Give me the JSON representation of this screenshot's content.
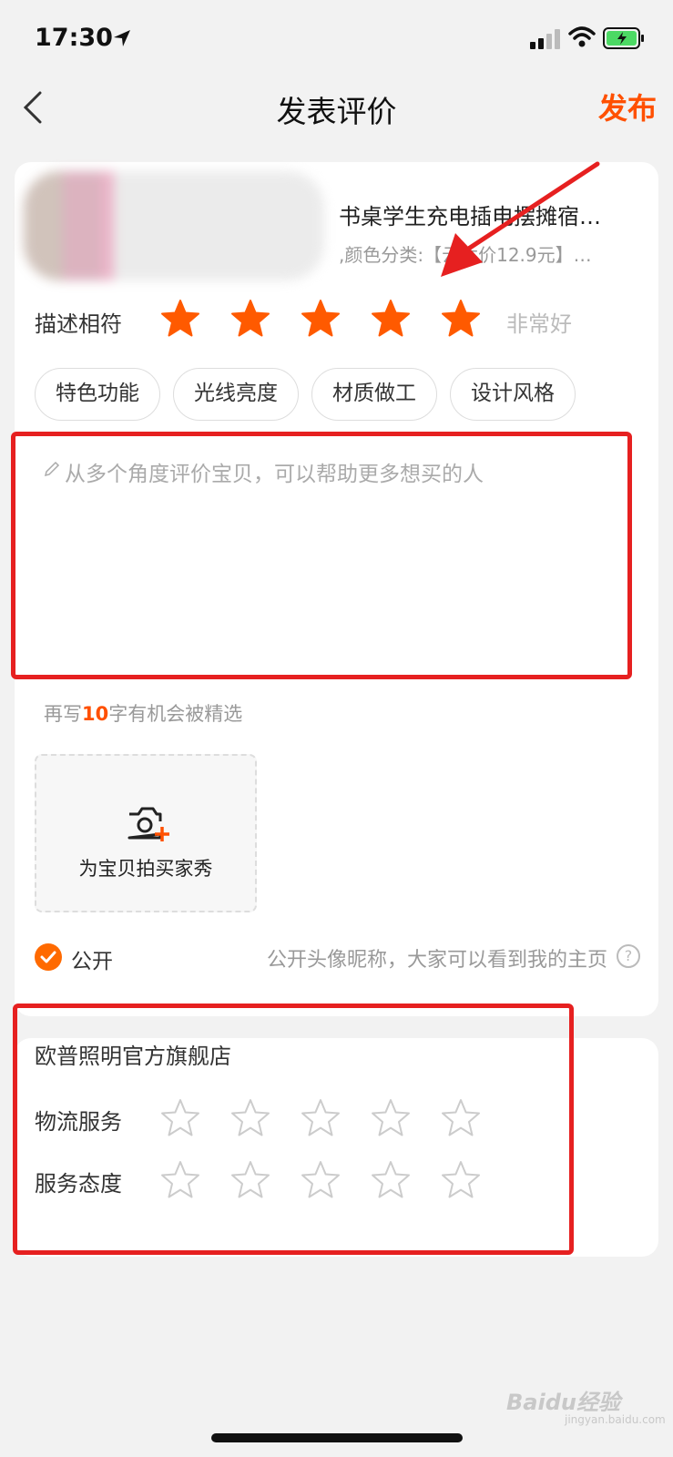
{
  "status_bar": {
    "time": "17:30"
  },
  "nav": {
    "title": "发表评价",
    "publish_label": "发布"
  },
  "product": {
    "title": "书桌学生充电插电摆摊宿…",
    "sku": ",颜色分类:【云木价12.9元】…"
  },
  "rating": {
    "label": "描述相符",
    "value": 5,
    "max": 5,
    "text": "非常好"
  },
  "tags": [
    "特色功能",
    "光线亮度",
    "材质做工",
    "设计风格"
  ],
  "review": {
    "placeholder": "从多个角度评价宝贝，可以帮助更多想买的人",
    "value": ""
  },
  "hint": {
    "prefix": "再写",
    "count": "10",
    "suffix": "字有机会被精选"
  },
  "photo": {
    "label": "为宝贝拍买家秀"
  },
  "public": {
    "checked": true,
    "label": "公开",
    "description": "公开头像昵称，大家可以看到我的主页",
    "help": "?"
  },
  "shop": {
    "name": "欧普照明官方旗舰店",
    "services": [
      {
        "label": "物流服务",
        "value": 0,
        "max": 5
      },
      {
        "label": "服务态度",
        "value": 0,
        "max": 5
      }
    ]
  },
  "watermark": {
    "brand": "Baidu经验",
    "url": "jingyan.baidu.com"
  },
  "colors": {
    "accent": "#ff5000",
    "annotation": "#e62020",
    "star_filled": "#ff5a00",
    "star_empty": "#cccccc"
  }
}
